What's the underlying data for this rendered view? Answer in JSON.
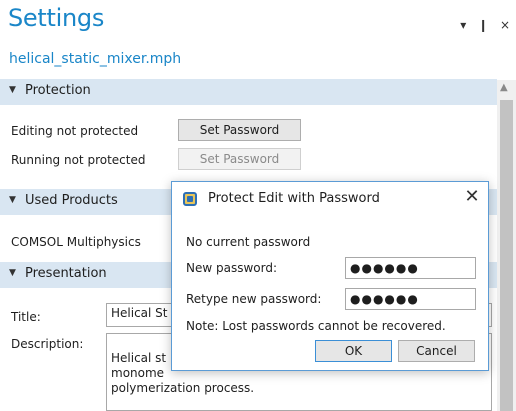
{
  "panel": {
    "title": "Settings",
    "subtitle": "helical_static_mixer.mph",
    "controls": "▾ ❙ ×"
  },
  "protection": {
    "header": "Protection",
    "editing_label": "Editing not protected",
    "running_label": "Running not protected",
    "set_password_enabled": "Set Password",
    "set_password_disabled": "Set Password"
  },
  "used_products": {
    "header": "Used Products",
    "item": "COMSOL Multiphysics"
  },
  "presentation": {
    "header": "Presentation",
    "title_label": "Title:",
    "title_value": "Helical St",
    "description_label": "Description:",
    "description_value": "Helical st\nmonome\npolymerization process."
  },
  "dialog": {
    "title": "Protect Edit with Password",
    "no_current": "No current password",
    "new_label": "New password:",
    "new_value": "●●●●●●",
    "retype_label": "Retype new password:",
    "retype_value": "●●●●●●",
    "note": "Note: Lost passwords cannot be recovered.",
    "ok": "OK",
    "cancel": "Cancel"
  },
  "icons": {
    "collapse": "chevron-down-icon",
    "dialog": "shield-lock-icon",
    "close": "close-icon"
  }
}
